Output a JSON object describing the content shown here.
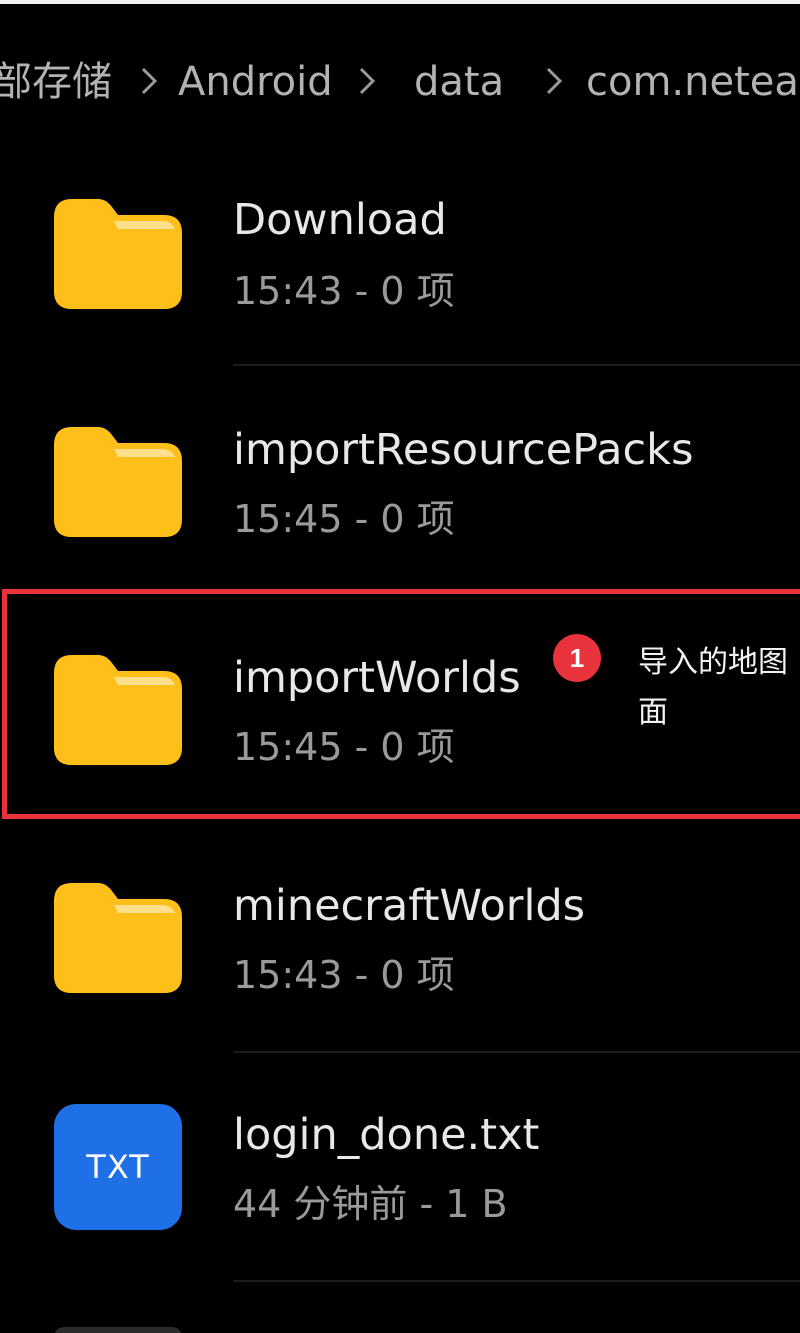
{
  "breadcrumb": {
    "items": [
      "部存储",
      "Android",
      "data",
      "com.neteas"
    ]
  },
  "files": [
    {
      "name": "Download",
      "meta": "15:43 - 0 项",
      "type": "folder"
    },
    {
      "name": "importResourcePacks",
      "meta": "15:45 - 0 项",
      "type": "folder"
    },
    {
      "name": "importWorlds",
      "meta": "15:45 - 0 项",
      "type": "folder"
    },
    {
      "name": "minecraftWorlds",
      "meta": "15:43 - 0 项",
      "type": "folder"
    },
    {
      "name": "login_done.txt",
      "meta": "44 分钟前 - 1 B",
      "type": "txt",
      "icon_label": "TXT"
    }
  ],
  "annotation": {
    "badge": "1",
    "callout_line1": "导入的地图",
    "callout_line2": "面",
    "color": "#e8323c"
  },
  "colors": {
    "folder": "#ffbf1a",
    "folder_tab": "#ffd95a",
    "txt_icon": "#1f6fe6"
  }
}
